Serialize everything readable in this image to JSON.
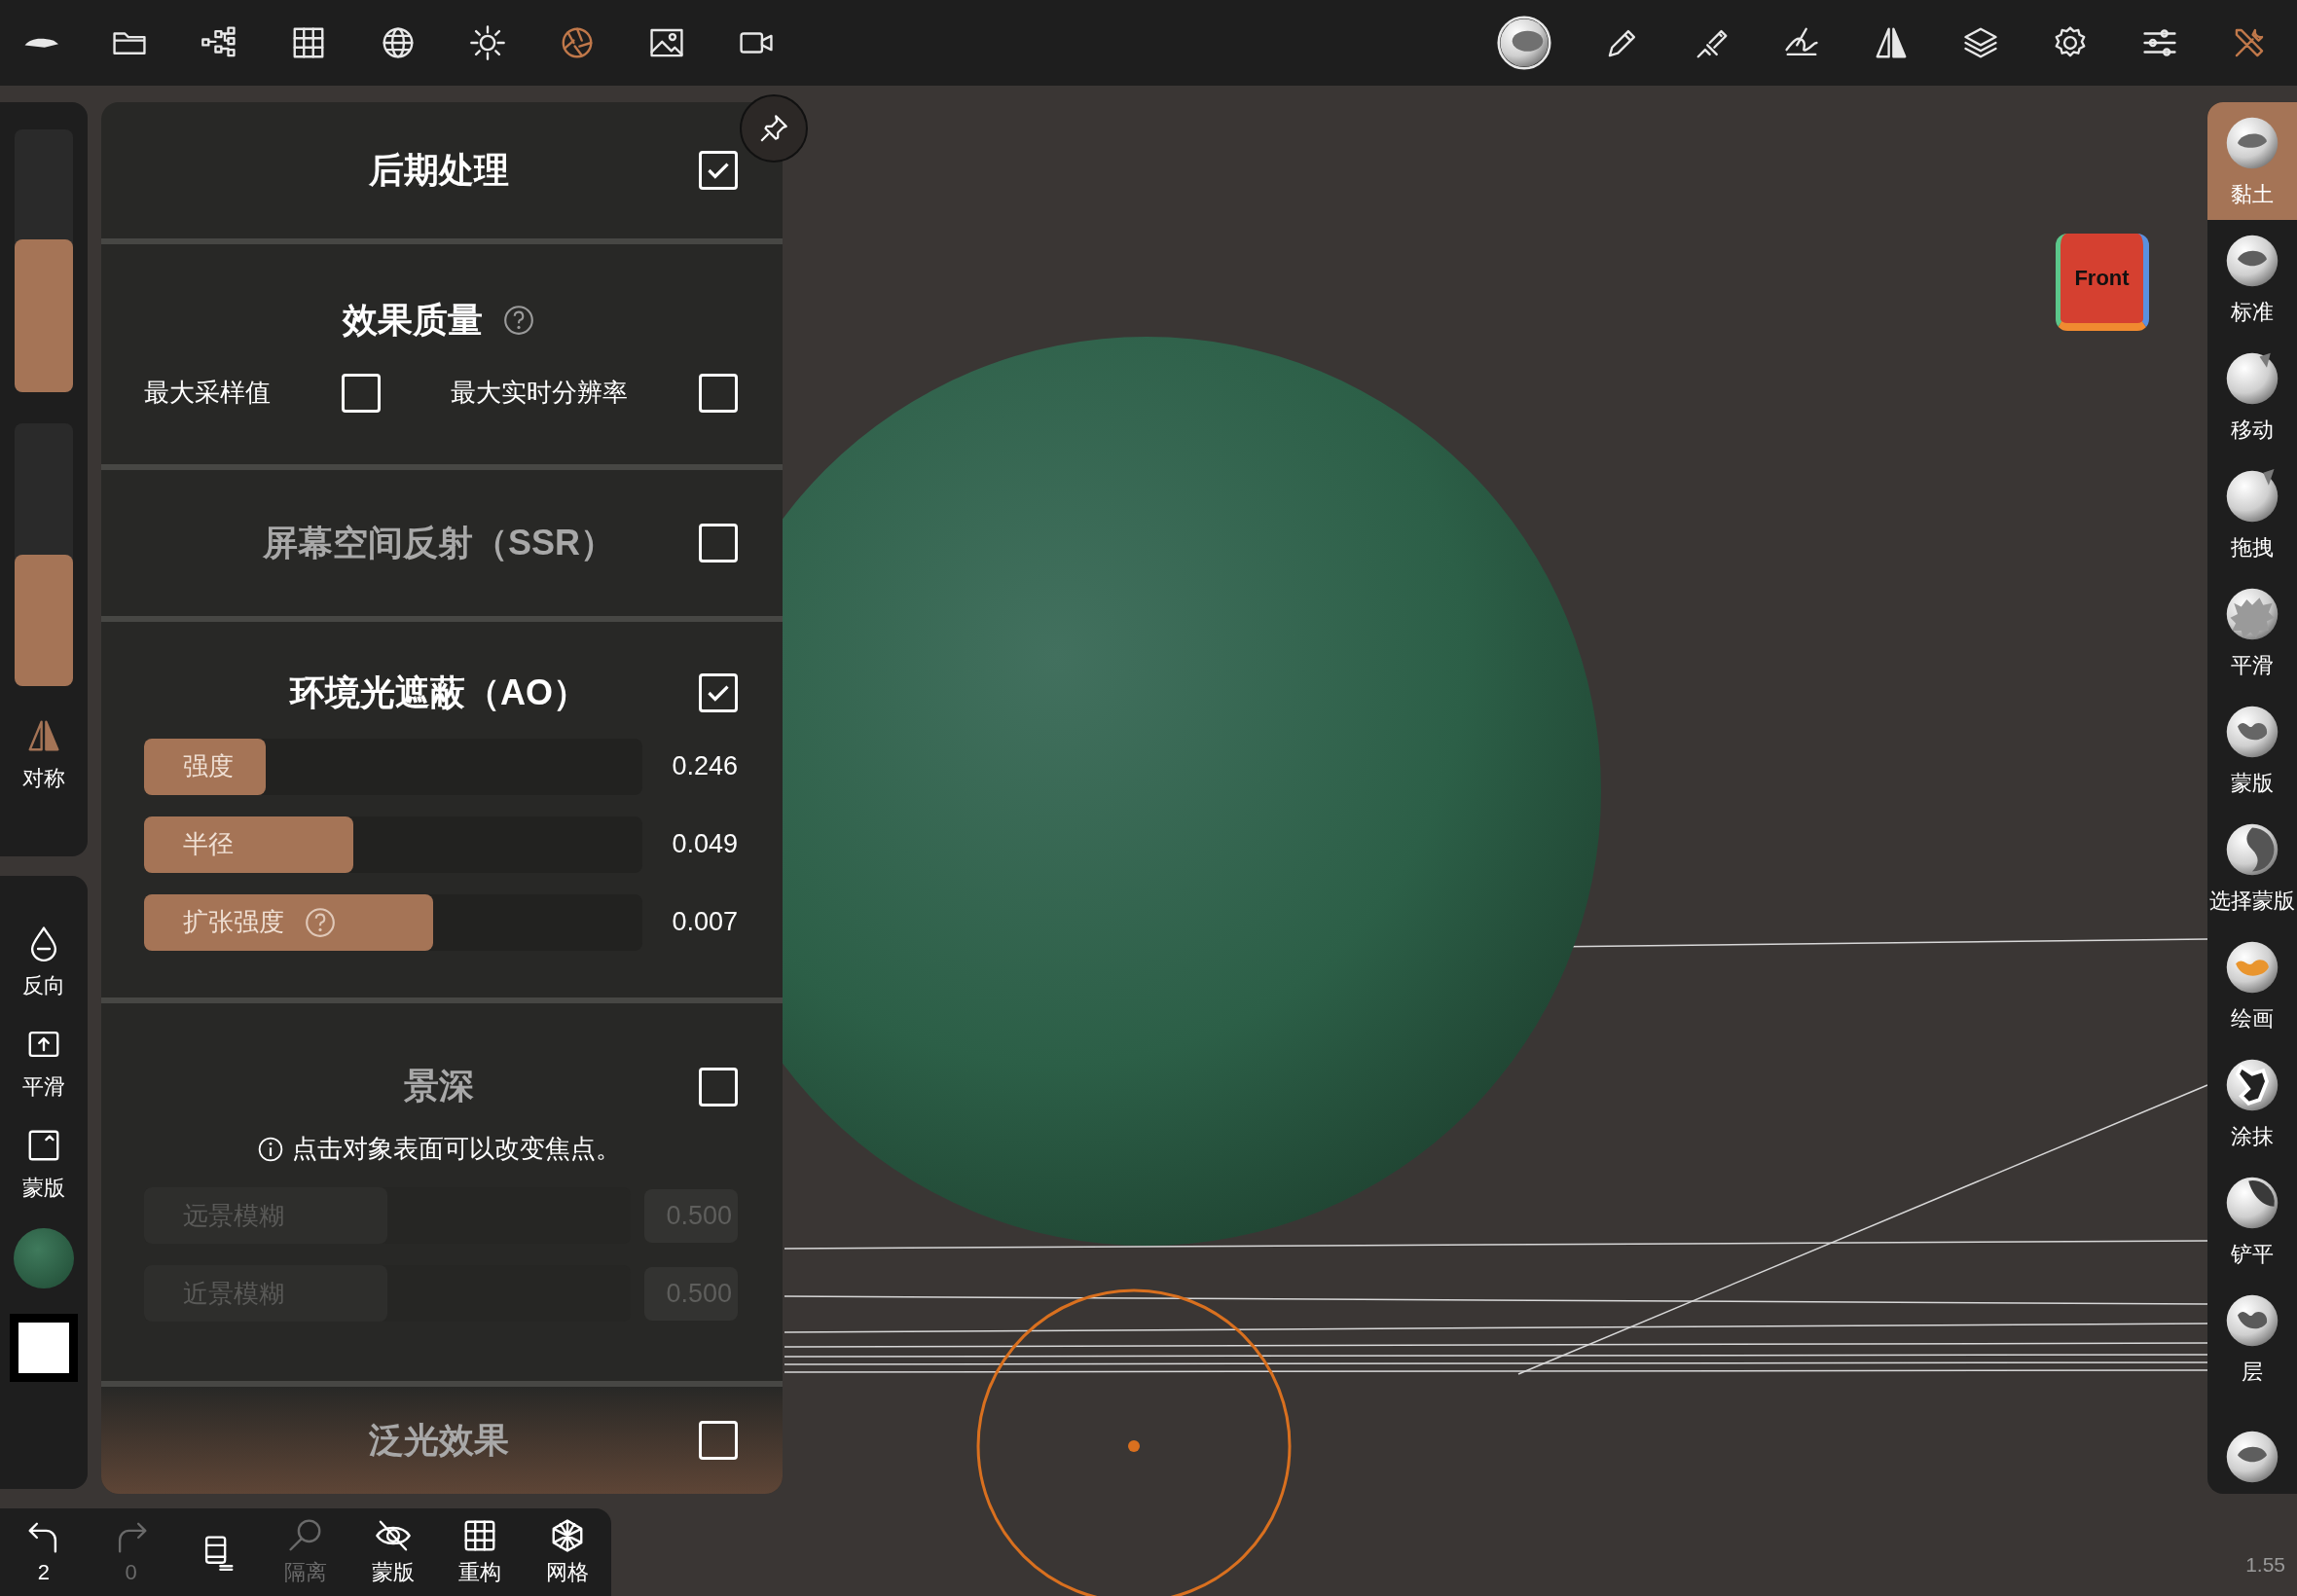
{
  "top_toolbar": {
    "left_tools": [
      {
        "kind": "logo",
        "selected": false
      },
      {
        "kind": "folder",
        "selected": false
      },
      {
        "kind": "scene",
        "selected": false
      },
      {
        "kind": "grid",
        "selected": false
      },
      {
        "kind": "topology",
        "selected": false
      },
      {
        "kind": "light",
        "selected": false
      },
      {
        "kind": "render",
        "selected": true
      },
      {
        "kind": "image",
        "selected": false
      },
      {
        "kind": "video",
        "selected": false
      }
    ],
    "right_tools": [
      {
        "kind": "material",
        "selected": false
      },
      {
        "kind": "pen",
        "selected": false
      },
      {
        "kind": "brush",
        "selected": false
      },
      {
        "kind": "stroke",
        "selected": false
      },
      {
        "kind": "symmetry",
        "selected": false
      },
      {
        "kind": "layers",
        "selected": false
      },
      {
        "kind": "settings",
        "selected": false
      },
      {
        "kind": "sliders",
        "selected": false
      },
      {
        "kind": "tools",
        "selected": true
      }
    ]
  },
  "left_sidebar": {
    "sliders": [
      {
        "level": 0.58
      },
      {
        "level": 0.5
      }
    ],
    "top_tools": [
      {
        "kind": "symmetry",
        "label": "对称"
      }
    ],
    "bottom_tools": [
      {
        "kind": "invert",
        "label": "反向"
      },
      {
        "kind": "smooth",
        "label": "平滑"
      },
      {
        "kind": "mask",
        "label": "蒙版"
      }
    ]
  },
  "panel": {
    "sections": [
      {
        "kind": "header",
        "title": "后期处理",
        "checked": true
      },
      {
        "kind": "quality",
        "title": "效果质量",
        "options": [
          {
            "label": "最大采样值",
            "checked": false
          },
          {
            "label": "最大实时分辨率",
            "checked": false
          }
        ]
      },
      {
        "kind": "toggle",
        "title": "屏幕空间反射（SSR）",
        "checked": false
      },
      {
        "kind": "sliders",
        "title": "环境光遮蔽（AO）",
        "checked": true,
        "sliders": [
          {
            "label": "强度",
            "level": 0.245,
            "value": "0.246",
            "help": false,
            "disabled": false
          },
          {
            "label": "半径",
            "level": 0.42,
            "value": "0.049",
            "help": false,
            "disabled": false
          },
          {
            "label": "扩张强度",
            "level": 0.58,
            "value": "0.007",
            "help": true,
            "disabled": false
          }
        ]
      },
      {
        "kind": "sliders",
        "title": "景深",
        "checked": false,
        "note": "点击对象表面可以改变焦点。",
        "sliders": [
          {
            "label": "远景模糊",
            "level": 0.5,
            "value": "0.500",
            "help": false,
            "disabled": true
          },
          {
            "label": "近景模糊",
            "level": 0.5,
            "value": "0.500",
            "help": false,
            "disabled": true
          }
        ]
      },
      {
        "kind": "toggle",
        "title": "泛光效果",
        "checked": false
      }
    ]
  },
  "viewport": {
    "view_cube": "Front"
  },
  "brushes": [
    {
      "kind": "clay",
      "label": "黏土",
      "selected": true
    },
    {
      "kind": "standard",
      "label": "标准",
      "selected": false
    },
    {
      "kind": "move",
      "label": "移动",
      "selected": false
    },
    {
      "kind": "drag",
      "label": "拖拽",
      "selected": false
    },
    {
      "kind": "smooth",
      "label": "平滑",
      "selected": false
    },
    {
      "kind": "mask",
      "label": "蒙版",
      "selected": false
    },
    {
      "kind": "select-mask",
      "label": "选择蒙版",
      "selected": false
    },
    {
      "kind": "paint",
      "label": "绘画",
      "selected": false
    },
    {
      "kind": "smudge",
      "label": "涂抹",
      "selected": false
    },
    {
      "kind": "flatten",
      "label": "铲平",
      "selected": false
    },
    {
      "kind": "layer",
      "label": "层",
      "selected": false
    },
    {
      "kind": "standard",
      "selected": false
    }
  ],
  "bottom_bar": [
    {
      "kind": "undo",
      "label": "2",
      "disabled": false
    },
    {
      "kind": "redo",
      "label": "0",
      "disabled": true
    },
    {
      "kind": "scene",
      "disabled": false
    },
    {
      "kind": "isolate",
      "label": "隔离",
      "disabled": true
    },
    {
      "kind": "hide",
      "label": "蒙版",
      "disabled": false
    },
    {
      "kind": "remesh",
      "label": "重构",
      "disabled": false
    },
    {
      "kind": "wireframe",
      "label": "网格",
      "disabled": false
    }
  ],
  "version": "1.55"
}
